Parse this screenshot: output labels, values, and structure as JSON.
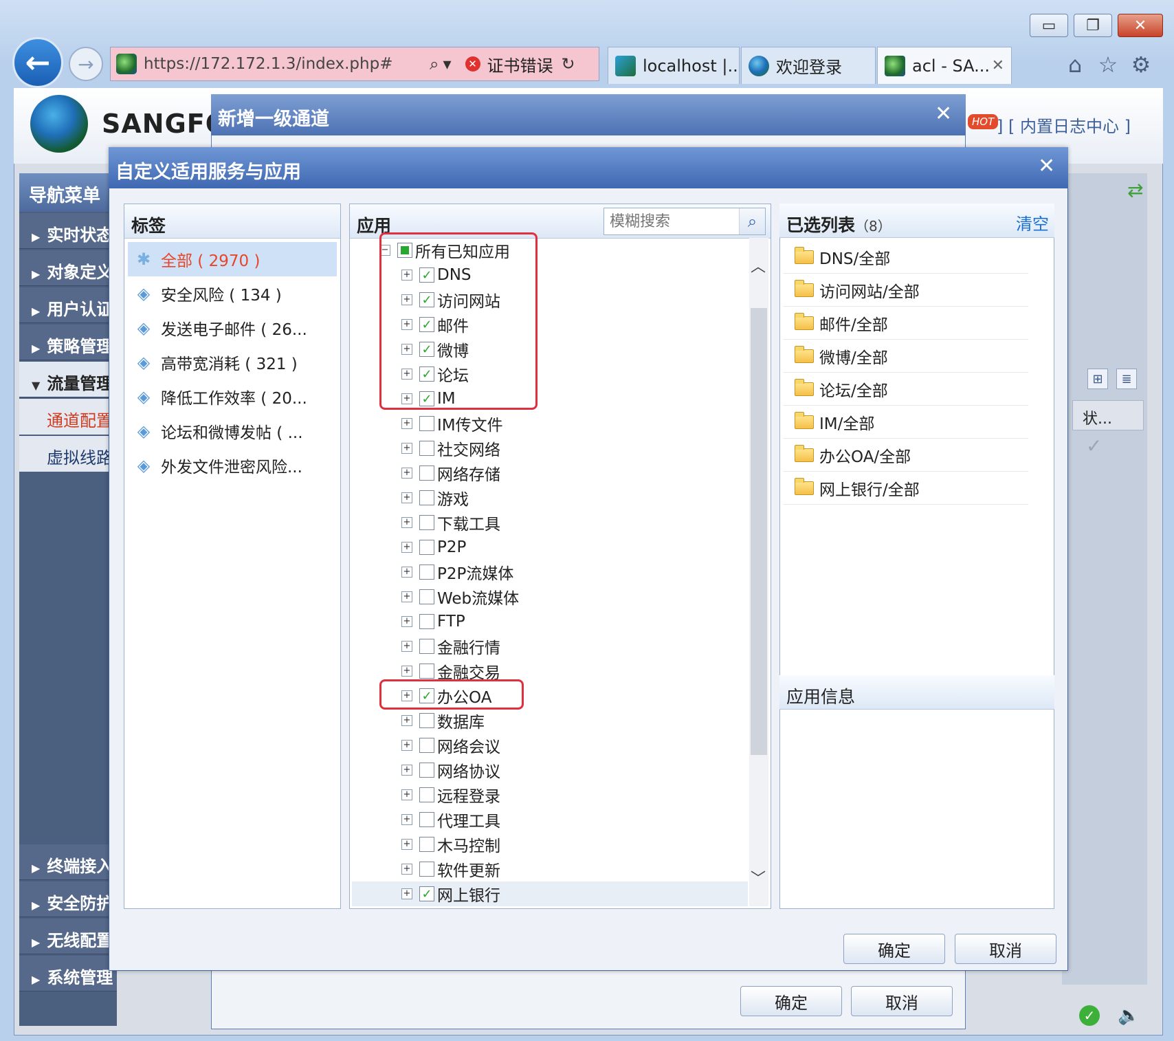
{
  "browser": {
    "url": "https://172.172.1.3/index.php#",
    "cert_error": "证书错误",
    "tabs": [
      {
        "label": "localhost |..."
      },
      {
        "label": "欢迎登录"
      },
      {
        "label": "acl - SA..."
      }
    ],
    "window_buttons": {
      "minimize": "▭",
      "restore": "❐",
      "close": "✕"
    }
  },
  "app": {
    "brand": "SANGFOR",
    "hot_badge": "HOT",
    "log_center": "] [ 内置日志中心 ]",
    "nav_title": "导航菜单",
    "nav_items": [
      "实时状态",
      "对象定义",
      "用户认证",
      "策略管理",
      "流量管理"
    ],
    "nav_sub_items": [
      "通道配置",
      "虚拟线路"
    ],
    "nav_items_bottom": [
      "终端接入",
      "安全防护",
      "无线配置",
      "系统管理"
    ],
    "right_table_header": "状..."
  },
  "back_modal": {
    "title": "新增一级通道",
    "ok": "确定",
    "cancel": "取消"
  },
  "dialog": {
    "title": "自定义适用服务与应用",
    "tag_panel": {
      "title": "标签",
      "items": [
        {
          "label": "全部 ( 2970 )",
          "icon": "asterisk-icon",
          "selected": true
        },
        {
          "label": "安全风险 ( 134 )",
          "icon": "tag-icon"
        },
        {
          "label": "发送电子邮件 ( 26...",
          "icon": "tag-icon"
        },
        {
          "label": "高带宽消耗 ( 321 )",
          "icon": "tag-icon"
        },
        {
          "label": "降低工作效率 ( 20...",
          "icon": "tag-icon"
        },
        {
          "label": "论坛和微博发帖 ( ...",
          "icon": "tag-icon"
        },
        {
          "label": "外发文件泄密风险...",
          "icon": "tag-icon"
        }
      ]
    },
    "app_panel": {
      "title": "应用",
      "search_placeholder": "模糊搜索",
      "root": {
        "label": "所有已知应用",
        "state": "partial"
      },
      "items": [
        {
          "label": "DNS",
          "checked": true
        },
        {
          "label": "访问网站",
          "checked": true
        },
        {
          "label": "邮件",
          "checked": true
        },
        {
          "label": "微博",
          "checked": true
        },
        {
          "label": "论坛",
          "checked": true
        },
        {
          "label": "IM",
          "checked": true
        },
        {
          "label": "IM传文件",
          "checked": false
        },
        {
          "label": "社交网络",
          "checked": false
        },
        {
          "label": "网络存储",
          "checked": false
        },
        {
          "label": "游戏",
          "checked": false
        },
        {
          "label": "下载工具",
          "checked": false
        },
        {
          "label": "P2P",
          "checked": false
        },
        {
          "label": "P2P流媒体",
          "checked": false
        },
        {
          "label": "Web流媒体",
          "checked": false
        },
        {
          "label": "FTP",
          "checked": false
        },
        {
          "label": "金融行情",
          "checked": false
        },
        {
          "label": "金融交易",
          "checked": false
        },
        {
          "label": "办公OA",
          "checked": true
        },
        {
          "label": "数据库",
          "checked": false
        },
        {
          "label": "网络会议",
          "checked": false
        },
        {
          "label": "网络协议",
          "checked": false
        },
        {
          "label": "远程登录",
          "checked": false
        },
        {
          "label": "代理工具",
          "checked": false
        },
        {
          "label": "木马控制",
          "checked": false
        },
        {
          "label": "软件更新",
          "checked": false
        },
        {
          "label": "网上银行",
          "checked": true
        }
      ]
    },
    "selected_panel": {
      "title": "已选列表",
      "count": "（8）",
      "clear": "清空",
      "items": [
        "DNS/全部",
        "访问网站/全部",
        "邮件/全部",
        "微博/全部",
        "论坛/全部",
        "IM/全部",
        "办公OA/全部",
        "网上银行/全部"
      ]
    },
    "info_panel": {
      "title": "应用信息"
    },
    "ok": "确定",
    "cancel": "取消"
  }
}
